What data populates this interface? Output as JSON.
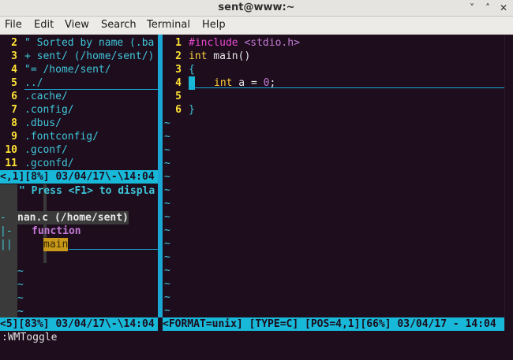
{
  "window": {
    "title": "sent@www:~",
    "minimize": "˅",
    "maximize": "˄",
    "close": "✕"
  },
  "menu": [
    "File",
    "Edit",
    "View",
    "Search",
    "Terminal",
    "Help"
  ],
  "explorer": {
    "lines": [
      {
        "num": "2",
        "text": "\" Sorted by name (.ba"
      },
      {
        "num": "3",
        "text": "+ sent/ (/home/sent/)"
      },
      {
        "num": "4",
        "text": "\"= /home/sent/"
      },
      {
        "num": "5",
        "text": "../"
      },
      {
        "num": "6",
        "text": ".cache/"
      },
      {
        "num": "7",
        "text": ".config/"
      },
      {
        "num": "8",
        "text": ".dbus/"
      },
      {
        "num": "9",
        "text": ".fontconfig/"
      },
      {
        "num": "10",
        "text": ".gconf/"
      },
      {
        "num": "11",
        "text": ".gconfd/"
      }
    ],
    "status": "<,1][8%] 03/04/17\\-\\14:04"
  },
  "taglist": {
    "help": "\" Press <F1> to displa",
    "file_marker": "-",
    "file": "nan.c (/home/sent)",
    "func_marker": "|-",
    "func": "function",
    "item_marker": "||",
    "item": "main",
    "status": "<5][83%] 03/04/17\\-\\14:04"
  },
  "editor": {
    "lines": [
      {
        "num": "1",
        "pre": "#include ",
        "post": "<stdio.h>"
      },
      {
        "num": "2",
        "type": "int",
        "rest": " main()"
      },
      {
        "num": "3",
        "brace": "{"
      },
      {
        "num": "4",
        "kw": "int",
        "mid": " a = ",
        "val": "0",
        "end": ";"
      },
      {
        "num": "5"
      },
      {
        "num": "6",
        "brace": "}"
      }
    ],
    "tilde": "~",
    "status": "<FORMAT=unix] [TYPE=C] [POS=4,1][66%] 03/04/17 - 14:04"
  },
  "cmdline": ":WMToggle",
  "colors": {
    "status_bg": "#18b8d8",
    "linenumber": "#ffe135",
    "tilde": "#3fc6d9",
    "background": "#1d0d1d"
  }
}
